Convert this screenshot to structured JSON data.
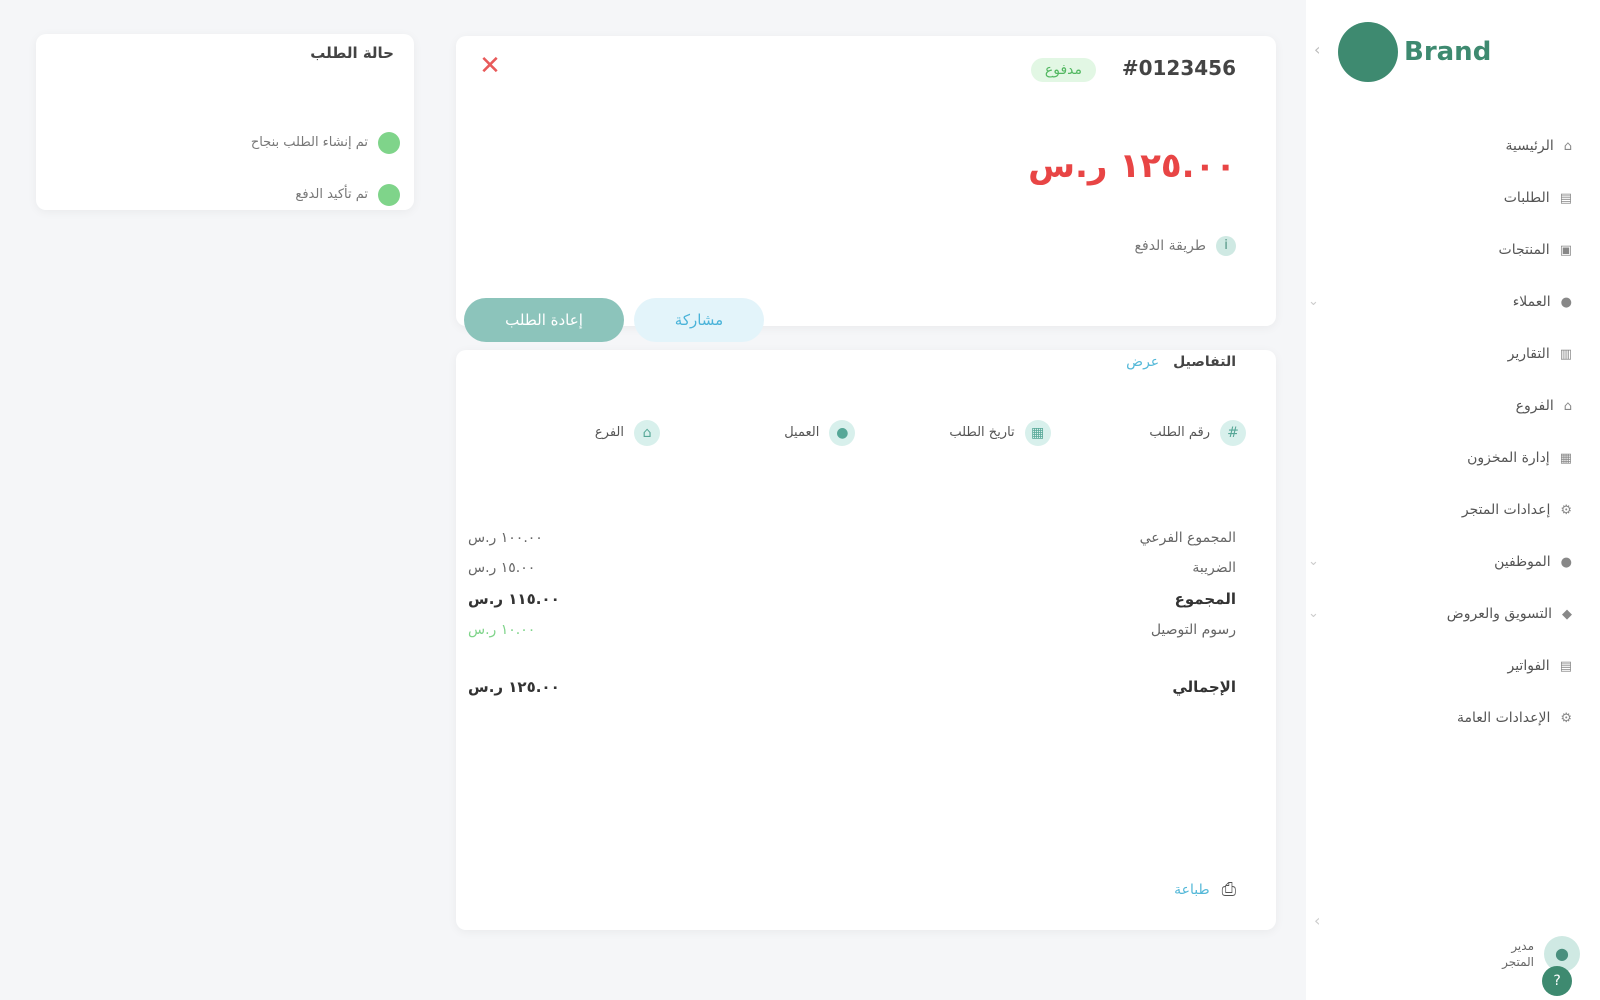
{
  "status_card": {
    "title": "حالة الطلب",
    "rows": [
      {
        "text": "تم إنشاء الطلب بنجاح"
      },
      {
        "text": "تم تأكيد الدفع"
      }
    ]
  },
  "summary": {
    "order_id": "#0123456",
    "status": "مدفوع",
    "amount": "١٢٥.٠٠ ر.س",
    "sub_line": "طريقة الدفع",
    "buttons": {
      "primary": "إعادة الطلب",
      "secondary": "مشاركة"
    }
  },
  "detail": {
    "title": "التفاصيل",
    "link": "عرض",
    "info_cells": [
      {
        "label": "رقم الطلب",
        "icon": "hash-icon"
      },
      {
        "label": "تاريخ الطلب",
        "icon": "calendar-icon"
      },
      {
        "label": "العميل",
        "icon": "user-icon"
      },
      {
        "label": "الفرع",
        "icon": "store-icon"
      }
    ],
    "rows": [
      {
        "label": "المجموع الفرعي",
        "value": "١٠٠.٠٠ ر.س",
        "bold": false,
        "green": false
      },
      {
        "label": "الضريبة",
        "value": "١٥.٠٠ ر.س",
        "bold": false,
        "green": false
      },
      {
        "label": "المجموع",
        "value": "١١٥.٠٠ ر.س",
        "bold": true,
        "green": false
      },
      {
        "label": "رسوم التوصيل",
        "value": "١٠.٠٠ ر.س",
        "bold": false,
        "green": true
      },
      {
        "label": "الإجمالي",
        "value": "١٢٥.٠٠ ر.س",
        "bold": true,
        "green": false
      }
    ],
    "footer_link": "طباعة"
  },
  "sidebar": {
    "brand": "Brand",
    "items": [
      {
        "label": "الرئيسية"
      },
      {
        "label": "الطلبات"
      },
      {
        "label": "المنتجات"
      },
      {
        "label": "العملاء"
      },
      {
        "label": "التقارير"
      },
      {
        "label": "الفروع"
      },
      {
        "label": "إدارة المخزون"
      },
      {
        "label": "إعدادات المتجر"
      },
      {
        "label": "الموظفين"
      },
      {
        "label": "التسويق والعروض"
      },
      {
        "label": "الفواتير"
      },
      {
        "label": "الإعدادات العامة"
      }
    ],
    "user": {
      "name": "مدير",
      "role": "المتجر"
    }
  }
}
